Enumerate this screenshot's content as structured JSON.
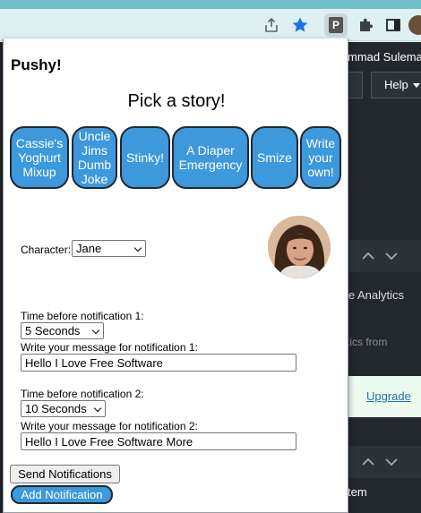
{
  "browser": {
    "toolbar": {
      "share_icon": "share-icon",
      "star_icon": "bookmark-star-icon",
      "extension_icon_letter": "P",
      "puzzle_icon": "extensions-puzzle-icon",
      "sidepanel_icon": "side-panel-icon"
    }
  },
  "background_page": {
    "user_name_partial": "mmad Sulema",
    "help_label": "Help",
    "analytics_text": "le Analytics",
    "tics_from_text": "rtics from",
    "upgrade_link": "Upgrade",
    "item_text": "tem"
  },
  "popup": {
    "title": "Pushy!",
    "heading": "Pick a story!",
    "stories": [
      {
        "label": "Cassie's Yoghurt Mixup"
      },
      {
        "label": "Uncle Jims Dumb Joke"
      },
      {
        "label": "Stinky!"
      },
      {
        "label": "A Diaper Emergency"
      },
      {
        "label": "Smize"
      },
      {
        "label": "Write your own!"
      }
    ],
    "character": {
      "label": "Character:",
      "selected": "Jane"
    },
    "notifications": [
      {
        "time_label": "Time before notification 1:",
        "time_selected": "5 Seconds",
        "message_label": "Write your message for notification 1:",
        "message_value": "Hello I Love Free Software"
      },
      {
        "time_label": "Time before notification 2:",
        "time_selected": "10 Seconds",
        "message_label": "Write your message for notification 2:",
        "message_value": "Hello I Love Free Software More"
      }
    ],
    "send_label": "Send Notifications",
    "add_label": "Add Notification"
  },
  "colors": {
    "story_button": "#3d98dc",
    "story_border": "#1e2a33",
    "chrome_toolbar": "#dff0f2",
    "page_dark": "#23282d",
    "accent_blue": "#1a73e8"
  }
}
